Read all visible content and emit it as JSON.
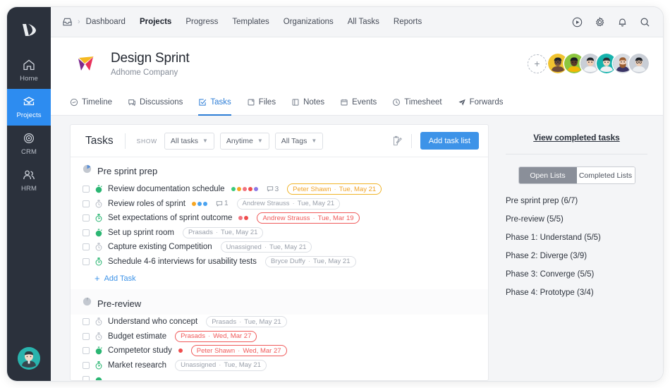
{
  "rail": {
    "logo": "app-logo",
    "items": [
      {
        "label": "Home",
        "icon": "home-icon",
        "active": false
      },
      {
        "label": "Projects",
        "icon": "projects-icon",
        "active": true
      },
      {
        "label": "CRM",
        "icon": "crm-icon",
        "active": false
      },
      {
        "label": "HRM",
        "icon": "hrm-icon",
        "active": false
      }
    ]
  },
  "topbar": {
    "home_icon": "inbox-icon",
    "separator": "›",
    "links": [
      {
        "label": "Dashboard",
        "active": false
      },
      {
        "label": "Projects",
        "active": true
      },
      {
        "label": "Progress",
        "active": false
      },
      {
        "label": "Templates",
        "active": false
      },
      {
        "label": "Organizations",
        "active": false
      },
      {
        "label": "All Tasks",
        "active": false
      },
      {
        "label": "Reports",
        "active": false
      }
    ],
    "actions": [
      "play-circle-icon",
      "gear-icon",
      "bell-icon",
      "search-icon"
    ]
  },
  "project": {
    "title": "Design Sprint",
    "subtitle": "Adhome Company",
    "add_member_label": "+",
    "avatars": [
      "avatar-1",
      "avatar-2",
      "avatar-3",
      "avatar-4",
      "avatar-5",
      "avatar-6"
    ]
  },
  "tabs": [
    {
      "label": "Timeline",
      "icon": "timeline-icon",
      "active": false
    },
    {
      "label": "Discussions",
      "icon": "discussions-icon",
      "active": false
    },
    {
      "label": "Tasks",
      "icon": "tasks-icon",
      "active": true
    },
    {
      "label": "Files",
      "icon": "files-icon",
      "active": false
    },
    {
      "label": "Notes",
      "icon": "notes-icon",
      "active": false
    },
    {
      "label": "Events",
      "icon": "events-icon",
      "active": false
    },
    {
      "label": "Timesheet",
      "icon": "timesheet-icon",
      "active": false
    },
    {
      "label": "Forwards",
      "icon": "forwards-icon",
      "active": false
    }
  ],
  "tasks_toolbar": {
    "title": "Tasks",
    "show_label": "SHOW",
    "filters": [
      {
        "label": "All tasks"
      },
      {
        "label": "Anytime"
      },
      {
        "label": "All Tags"
      }
    ],
    "edit_icon": "edit-note-icon",
    "add_list_label": "Add task list",
    "accent": "#3d93e8"
  },
  "sections": [
    {
      "name": "Pre sprint prep",
      "progress_icon": "pie-progress-icon",
      "tasks": [
        {
          "name": "Review documentation schedule",
          "timer": "green-solid",
          "dots": [
            "#3cc97b",
            "#f6a623",
            "#f2737f",
            "#ef4d4d",
            "#8c7ae6"
          ],
          "comments": "3",
          "chip": {
            "person": "Peter Shawn",
            "date": "Tue, May 21",
            "style": "amber"
          }
        },
        {
          "name": "Review roles of sprint",
          "timer": "gray",
          "dots": [
            "#f6a623",
            "#4aa3f0",
            "#4aa3f0"
          ],
          "comments": "1",
          "chip": {
            "person": "Andrew Strauss",
            "date": "Tue, May 21",
            "style": "plain"
          }
        },
        {
          "name": "Set expectations of sprint outcome",
          "timer": "green-outline",
          "dots": [
            "#f2737f",
            "#ef4d4d"
          ],
          "comments": "",
          "chip": {
            "person": "Andrew Strauss",
            "date": "Tue, Mar 19",
            "style": "red"
          }
        },
        {
          "name": "Set up sprint room",
          "timer": "green-solid",
          "dots": [],
          "comments": "",
          "chip": {
            "person": "Prasads",
            "date": "Tue, May 21",
            "style": "plain"
          }
        },
        {
          "name": "Capture existing Competition",
          "timer": "gray",
          "dots": [],
          "comments": "",
          "chip": {
            "person": "Unassigned",
            "date": "Tue, May 21",
            "style": "plain"
          }
        },
        {
          "name": "Schedule 4-6 interviews for usability tests",
          "timer": "green-outline",
          "dots": [],
          "comments": "",
          "chip": {
            "person": "Bryce Duffy",
            "date": "Tue, May 21",
            "style": "plain"
          }
        }
      ],
      "add_task_label": "Add Task"
    },
    {
      "name": "Pre-review",
      "progress_icon": "pie-progress-icon",
      "tasks": [
        {
          "name": "Understand who concept",
          "timer": "gray",
          "dots": [],
          "comments": "",
          "chip": {
            "person": "Prasads",
            "date": "Tue, May 21",
            "style": "plain"
          }
        },
        {
          "name": "Budget estimate",
          "timer": "gray",
          "dots": [],
          "comments": "",
          "chip": {
            "person": "Prasads",
            "date": "Wed, Mar 27",
            "style": "red"
          }
        },
        {
          "name": "Competetor study",
          "timer": "green-solid",
          "dots": [
            "#ef4d4d"
          ],
          "comments": "",
          "chip": {
            "person": "Peter Shawn",
            "date": "Wed, Mar 27",
            "style": "red"
          }
        },
        {
          "name": "Market research",
          "timer": "green-outline",
          "dots": [],
          "comments": "",
          "chip": {
            "person": "Unassigned",
            "date": "Tue, May 21",
            "style": "plain"
          }
        }
      ],
      "add_task_label": ""
    }
  ],
  "right_panel": {
    "view_completed_label": "View completed tasks",
    "segments": [
      {
        "label": "Open Lists",
        "active": true
      },
      {
        "label": "Completed Lists",
        "active": false
      }
    ],
    "lists": [
      "Pre sprint prep (6/7)",
      "Pre-review (5/5)",
      "Phase 1: Understand (5/5)",
      "Phase 2: Diverge (3/9)",
      "Phase 3: Converge (5/5)",
      "Phase 4: Prototype (3/4)"
    ]
  }
}
